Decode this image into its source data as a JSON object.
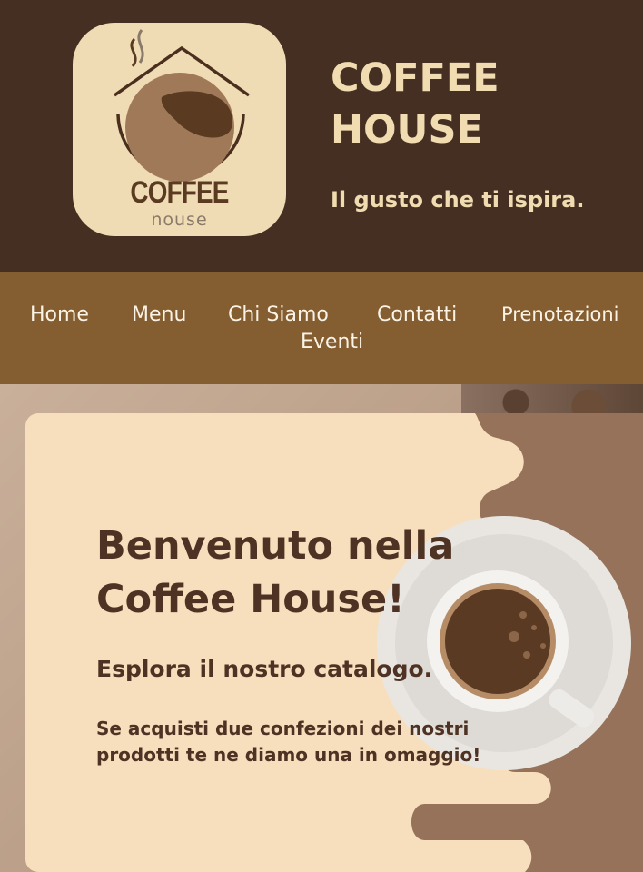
{
  "header": {
    "logo_text_1": "COFFEE",
    "logo_text_2": "nouse",
    "title": "COFFEE HOUSE",
    "tagline": "Il gusto che ti ispira."
  },
  "nav": {
    "items": [
      "Home",
      "Menu",
      "Chi Siamo",
      "Contatti",
      "Prenotazioni",
      "Eventi"
    ]
  },
  "hero": {
    "title": "Benvenuto nella Coffee House!",
    "subtitle": "Esplora il nostro catalogo.",
    "promo": "Se acquisti due confezioni dei nostri prodotti te ne diamo una in omaggio!"
  },
  "colors": {
    "header_bg": "#452f22",
    "nav_bg": "#845d31",
    "card_bg": "#f7dfbd",
    "accent_text": "#f0dcb0",
    "heading_text": "#4e3223"
  },
  "icons": {
    "logo": "coffee-house-logo-icon",
    "cup": "coffee-cup-icon"
  }
}
